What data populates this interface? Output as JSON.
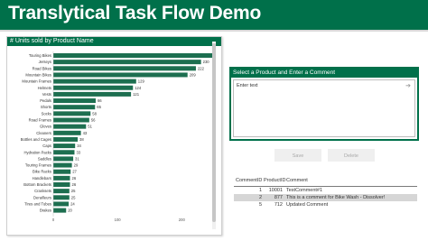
{
  "header": {
    "title": "Translytical Task Flow Demo"
  },
  "chart": {
    "title": "# Units sold by Product Name",
    "bar_color": "#1d6f50"
  },
  "chart_data": {
    "type": "bar",
    "orientation": "horizontal",
    "title": "# Units sold by Product Name",
    "categories": [
      "Touring Bikes",
      "Jerseys",
      "Road Bikes",
      "Mountain Bikes",
      "Mountain Frames",
      "Helmets",
      "Vests",
      "Pedals",
      "Shorts",
      "Socks",
      "Road Frames",
      "Gloves",
      "Cleaners",
      "Bottles and Cages",
      "Caps",
      "Hydration Packs",
      "Saddles",
      "Touring Frames",
      "Bike Racks",
      "Handlebars",
      "Bottom Brackets",
      "Cranksets",
      "Derailleurs",
      "Tires and Tubes",
      "Brakes"
    ],
    "values": [
      252,
      230,
      222,
      209,
      129,
      124,
      121,
      66,
      65,
      58,
      56,
      51,
      43,
      38,
      34,
      33,
      31,
      29,
      27,
      26,
      26,
      25,
      25,
      24,
      20
    ],
    "xticks": [
      0,
      100,
      200
    ],
    "xlim": [
      0,
      260
    ]
  },
  "form": {
    "title": "Select a Product and Enter a Comment",
    "placeholder": "Enter text",
    "send_icon": "send-arrow-icon",
    "save_label": "Save",
    "delete_label": "Delete"
  },
  "table": {
    "columns": [
      "CommentID",
      "ProductID",
      "Comment"
    ],
    "rows": [
      [
        "1",
        "10001",
        "TestComment#1"
      ],
      [
        "2",
        "877",
        "This is a comment for Bike Wash - Dissolver!"
      ],
      [
        "5",
        "712",
        "Updated Comment"
      ]
    ]
  },
  "colors": {
    "header": "#00704a",
    "bar": "#1d6f50",
    "selected_row": "#d6d6d6"
  }
}
